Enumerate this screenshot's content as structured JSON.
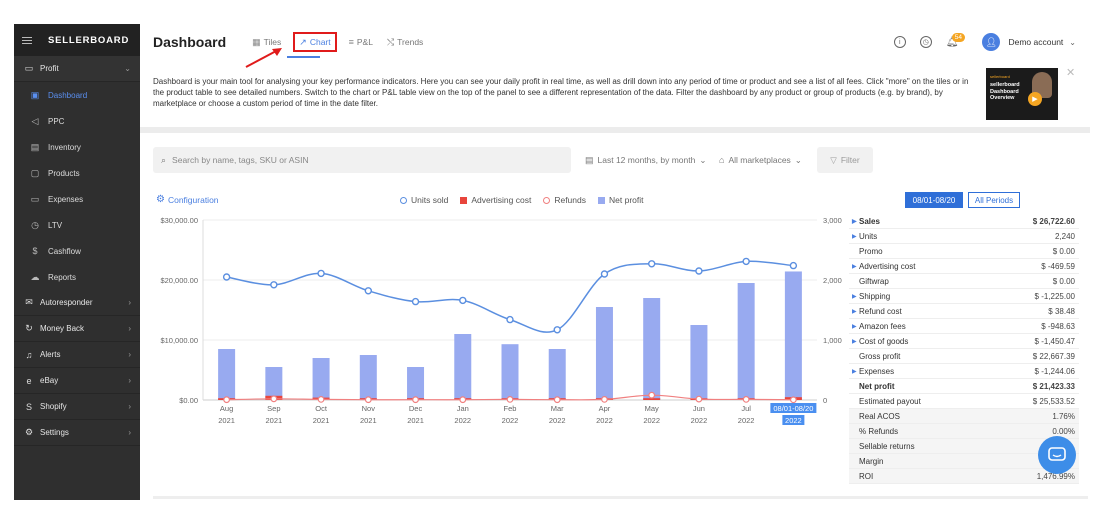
{
  "sidebar": {
    "brand": "SELLERBOARD",
    "profit_label": "Profit",
    "sub_items": [
      {
        "label": "Dashboard",
        "icon": "dashboard-icon"
      },
      {
        "label": "PPC",
        "icon": "megaphone-icon"
      },
      {
        "label": "Inventory",
        "icon": "inventory-icon"
      },
      {
        "label": "Products",
        "icon": "products-icon"
      },
      {
        "label": "Expenses",
        "icon": "expenses-icon"
      },
      {
        "label": "LTV",
        "icon": "ltv-icon"
      },
      {
        "label": "Cashflow",
        "icon": "dollar-icon"
      },
      {
        "label": "Reports",
        "icon": "reports-icon"
      }
    ],
    "sections": [
      {
        "label": "Autoresponder",
        "icon": "mail-icon"
      },
      {
        "label": "Money Back",
        "icon": "refresh-icon"
      },
      {
        "label": "Alerts",
        "icon": "bell-icon"
      },
      {
        "label": "eBay",
        "icon": "ebay-icon"
      },
      {
        "label": "Shopify",
        "icon": "shopify-icon"
      },
      {
        "label": "Settings",
        "icon": "gear-icon"
      }
    ]
  },
  "header": {
    "title": "Dashboard",
    "tabs": [
      {
        "label": "Tiles"
      },
      {
        "label": "Chart"
      },
      {
        "label": "P&L"
      },
      {
        "label": "Trends"
      }
    ],
    "notification_count": "54",
    "account": "Demo account"
  },
  "info": {
    "text": "Dashboard is your main tool for analysing your key performance indicators. Here you can see your daily profit in real time, as well as drill down into any period of time or product and see a list of all fees. Click \"more\" on the tiles or in the product table to see detailed numbers. Switch to the chart or P&L table view on the top of the panel to see a different representation of the data. Filter the dashboard by any product or group of products (e.g. by brand), by marketplace or choose a custom period of time in the date filter.",
    "video_brand": "sellerboard",
    "video_title": "sellerboard Dashboard Overview"
  },
  "filters": {
    "search_placeholder": "Search by name, tags, SKU or ASIN",
    "period": "Last 12 months, by month",
    "marketplace": "All marketplaces",
    "filter_label": "Filter"
  },
  "chart": {
    "config_label": "Configuration",
    "legend": [
      {
        "name": "Units sold",
        "color": "#5b8fe0",
        "shape": "circle"
      },
      {
        "name": "Advertising cost",
        "color": "#e8453c",
        "shape": "square"
      },
      {
        "name": "Refunds",
        "color": "#f08080",
        "shape": "circle"
      },
      {
        "name": "Net profit",
        "color": "#98aaf0",
        "shape": "square"
      }
    ]
  },
  "chart_data": {
    "type": "bar",
    "categories": [
      [
        "Aug",
        "2021"
      ],
      [
        "Sep",
        "2021"
      ],
      [
        "Oct",
        "2021"
      ],
      [
        "Nov",
        "2021"
      ],
      [
        "Dec",
        "2021"
      ],
      [
        "Jan",
        "2022"
      ],
      [
        "Feb",
        "2022"
      ],
      [
        "Mar",
        "2022"
      ],
      [
        "Apr",
        "2022"
      ],
      [
        "May",
        "2022"
      ],
      [
        "Jun",
        "2022"
      ],
      [
        "Jul",
        "2022"
      ],
      [
        "08/01-08/20",
        "2022"
      ]
    ],
    "series": [
      {
        "name": "Net profit",
        "type": "bar",
        "axis": "left",
        "color": "#98aaf0",
        "values": [
          8500,
          5500,
          7000,
          7500,
          5500,
          11000,
          9300,
          8500,
          15500,
          17000,
          12500,
          19500,
          21423
        ]
      },
      {
        "name": "Advertising cost",
        "type": "bar",
        "axis": "left",
        "color": "#e8453c",
        "values": [
          300,
          700,
          400,
          300,
          300,
          300,
          300,
          300,
          300,
          300,
          300,
          300,
          470
        ]
      },
      {
        "name": "Units sold",
        "type": "line",
        "axis": "right",
        "color": "#5b8fe0",
        "values": [
          2050,
          1920,
          2110,
          1820,
          1640,
          1660,
          1340,
          1170,
          2100,
          2270,
          2150,
          2310,
          2240
        ]
      },
      {
        "name": "Refunds",
        "type": "line",
        "axis": "left",
        "color": "#f08080",
        "values": [
          50,
          200,
          100,
          50,
          50,
          50,
          100,
          50,
          100,
          800,
          150,
          100,
          38
        ]
      }
    ],
    "left_axis": {
      "ticks": [
        "$0.00",
        "$10,000.00",
        "$20,000.00",
        "$30,000.00"
      ],
      "ylim": [
        0,
        30000
      ]
    },
    "right_axis": {
      "ticks": [
        "0",
        "1,000",
        "2,000",
        "3,000"
      ],
      "ylim": [
        0,
        3000
      ]
    },
    "highlight_category": "08/01-08/20",
    "grid": true
  },
  "summary": {
    "period_active": "08/01-08/20",
    "period_all": "All Periods",
    "rows": [
      {
        "label": "Sales",
        "value": "$ 26,722.60",
        "expand": true,
        "bold": true
      },
      {
        "label": "Units",
        "value": "2,240",
        "expand": true
      },
      {
        "label": "Promo",
        "value": "$ 0.00"
      },
      {
        "label": "Advertising cost",
        "value": "$ -469.59",
        "expand": true
      },
      {
        "label": "Giftwrap",
        "value": "$ 0.00"
      },
      {
        "label": "Shipping",
        "value": "$ -1,225.00",
        "expand": true
      },
      {
        "label": "Refund cost",
        "value": "$ 38.48",
        "expand": true
      },
      {
        "label": "Amazon fees",
        "value": "$ -948.63",
        "expand": true
      },
      {
        "label": "Cost of goods",
        "value": "$ -1,450.47",
        "expand": true
      },
      {
        "label": "Gross profit",
        "value": "$ 22,667.39"
      },
      {
        "label": "Expenses",
        "value": "$ -1,244.06",
        "expand": true
      },
      {
        "label": "Net profit",
        "value": "$ 21,423.33",
        "bold": true
      },
      {
        "label": "Estimated payout",
        "value": "$ 25,533.52"
      },
      {
        "label": "Real ACOS",
        "value": "1.76%",
        "shaded": true
      },
      {
        "label": "% Refunds",
        "value": "0.00%",
        "shaded": true
      },
      {
        "label": "Sellable returns",
        "value": "",
        "shaded": true
      },
      {
        "label": "Margin",
        "value": "",
        "shaded": true
      },
      {
        "label": "ROI",
        "value": "1,476.99%",
        "shaded": true
      }
    ]
  }
}
